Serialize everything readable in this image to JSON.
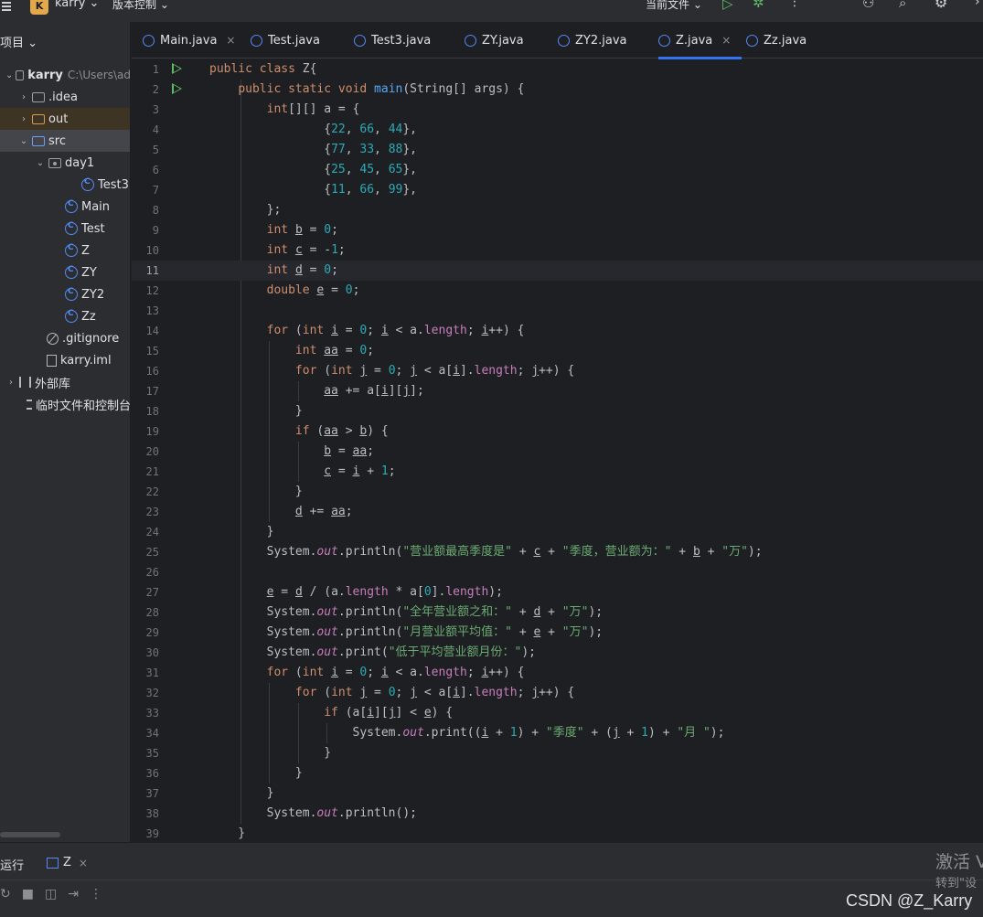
{
  "titlebar": {
    "project_badge": "K",
    "project_name": "karry ⌄",
    "vcs": "版本控制 ⌄",
    "current_file": "当前文件 ⌄"
  },
  "sidebar": {
    "header": "项目 ⌄",
    "rows": [
      {
        "label": "karry",
        "sub": "C:\\Users\\ad",
        "arrow": "⌄",
        "icon": "module-icon",
        "bold": true
      },
      {
        "label": ".idea",
        "arrow": "›",
        "icon": "folder-icon"
      },
      {
        "label": "out",
        "arrow": "›",
        "icon": "folder-excluded-icon"
      },
      {
        "label": "src",
        "arrow": "⌄",
        "icon": "source-folder-icon"
      },
      {
        "label": "day1",
        "arrow": "⌄",
        "icon": "package-icon"
      },
      {
        "label": "Test3",
        "arrow": "",
        "icon": "class-icon"
      },
      {
        "label": "Main",
        "arrow": "",
        "icon": "class-icon"
      },
      {
        "label": "Test",
        "arrow": "",
        "icon": "class-icon"
      },
      {
        "label": "Z",
        "arrow": "",
        "icon": "class-icon"
      },
      {
        "label": "ZY",
        "arrow": "",
        "icon": "class-icon"
      },
      {
        "label": "ZY2",
        "arrow": "",
        "icon": "class-icon"
      },
      {
        "label": "Zz",
        "arrow": "",
        "icon": "class-icon"
      },
      {
        "label": ".gitignore",
        "arrow": "",
        "icon": "gitignore-icon"
      },
      {
        "label": "karry.iml",
        "arrow": "",
        "icon": "iml-file-icon"
      },
      {
        "label": "外部库",
        "arrow": "›",
        "icon": "library-icon"
      },
      {
        "label": "临时文件和控制台",
        "arrow": "",
        "icon": "scratches-icon"
      }
    ]
  },
  "tabs": [
    {
      "label": "Main.java",
      "close": "×"
    },
    {
      "label": "Test.java",
      "close": ""
    },
    {
      "label": "Test3.java",
      "close": ""
    },
    {
      "label": "ZY.java",
      "close": ""
    },
    {
      "label": "ZY2.java",
      "close": ""
    },
    {
      "label": "Z.java",
      "close": "×",
      "active": true
    },
    {
      "label": "Zz.java",
      "close": ""
    }
  ],
  "editor": {
    "lines": [
      "public class Z{",
      "    public static void main(String[] args) {",
      "        int[][] a = {",
      "                {22, 66, 44},",
      "                {77, 33, 88},",
      "                {25, 45, 65},",
      "                {11, 66, 99},",
      "        };",
      "        int b = 0;",
      "        int c = -1;",
      "        int d = 0;",
      "        double e = 0;",
      "",
      "        for (int i = 0; i < a.length; i++) {",
      "            int aa = 0;",
      "            for (int j = 0; j < a[i].length; j++) {",
      "                aa += a[i][j];",
      "            }",
      "            if (aa > b) {",
      "                b = aa;",
      "                c = i + 1;",
      "            }",
      "            d += aa;",
      "        }",
      "        System.out.println(\"营业额最高季度是\" + c + \"季度，营业额为：\" + b + \"万\");",
      "",
      "        e = d / (a.length * a[0].length);",
      "        System.out.println(\"全年营业额之和：\" + d + \"万\");",
      "        System.out.println(\"月营业额平均值：\" + e + \"万\");",
      "        System.out.print(\"低于平均营业额月份：\");",
      "        for (int i = 0; i < a.length; i++) {",
      "            for (int j = 0; j < a[i].length; j++) {",
      "                if (a[i][j] < e) {",
      "                    System.out.print((i + 1) + \"季度\" + (j + 1) + \"月 \");",
      "                }",
      "            }",
      "        }",
      "        System.out.println();",
      "    }"
    ],
    "current_line": 11
  },
  "runpanel": {
    "title": "运行",
    "tab_label": "Z",
    "tab_close": "×"
  },
  "watermark": {
    "line1": "激活 V",
    "line2": "转到\"设"
  },
  "csdn": "CSDN @Z_Karry",
  "colors": {
    "keyword": "#cf8e6d",
    "method": "#56a8f5",
    "number": "#2aacb8",
    "string": "#6aab73",
    "static_field": "#c77dbb",
    "accent": "#3574f0",
    "run_green": "#5fb865"
  }
}
